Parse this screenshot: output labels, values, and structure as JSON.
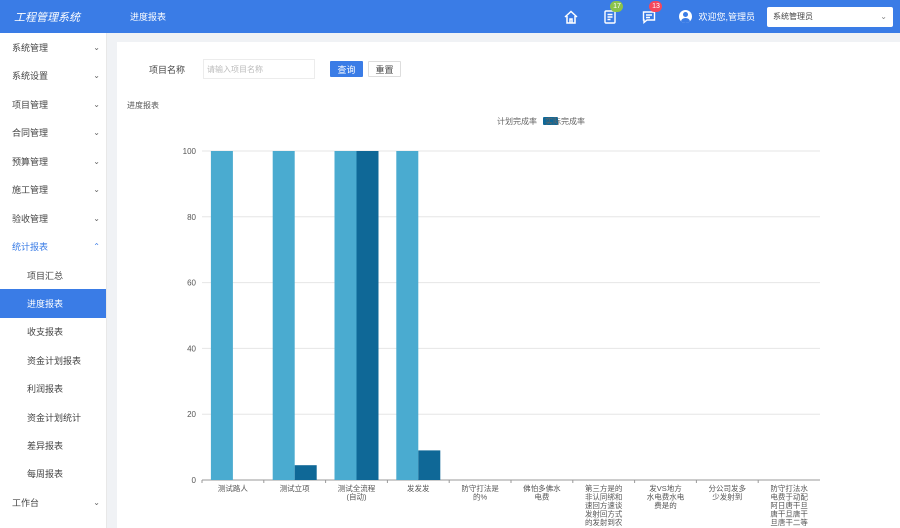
{
  "header": {
    "logo": "工程管理系统",
    "page_title": "进度报表",
    "badges": {
      "tasks": "17",
      "messages": "13"
    },
    "welcome": "欢迎您,管理员",
    "role_select": "系统管理员",
    "icons": [
      "home-icon",
      "task-list-icon",
      "message-icon",
      "user-avatar-icon",
      "chevron-down-icon"
    ]
  },
  "sidebar": {
    "items": [
      {
        "label": "系统管理"
      },
      {
        "label": "系统设置"
      },
      {
        "label": "项目管理"
      },
      {
        "label": "合同管理"
      },
      {
        "label": "预算管理"
      },
      {
        "label": "施工管理"
      },
      {
        "label": "验收管理"
      },
      {
        "label": "统计报表"
      }
    ],
    "sub_items": [
      {
        "label": "项目汇总"
      },
      {
        "label": "进度报表"
      },
      {
        "label": "收支报表"
      },
      {
        "label": "资金计划报表"
      },
      {
        "label": "利润报表"
      },
      {
        "label": "资金计划统计"
      },
      {
        "label": "差异报表"
      },
      {
        "label": "每周报表"
      }
    ],
    "bottom_item": {
      "label": "工作台"
    }
  },
  "search": {
    "label": "项目名称",
    "placeholder": "请输入项目名称",
    "query_button": "查询",
    "reset_button": "重置"
  },
  "colors": {
    "header": "#3a7ce6",
    "plan_bar": "#4aabd0",
    "actual_bar": "#0f6897"
  },
  "chart_data": {
    "type": "bar",
    "title": "进度报表",
    "categories": [
      "测试路人",
      "测试立项",
      "测试全流程\n(自动)",
      "发发发",
      "防守打法是\n的%",
      "佛怕多佛水\n电费",
      "第三方是的\n非认同绑和\n速回方速谈\n发射回方式\n的发射到农",
      "发VS地方\n水电费水电\n费是的",
      "分公司发多\n少发射到",
      "防守打法水\n电费于动配\n阿日唐干旦\n唐干旦唐干\n旦唐干二等"
    ],
    "series": [
      {
        "name": "计划完成率",
        "values": [
          100,
          100,
          100,
          100,
          0,
          0,
          0,
          0,
          0,
          0
        ]
      },
      {
        "name": "实际完成率",
        "values": [
          0,
          4.5,
          100,
          9,
          0,
          0,
          0,
          0,
          0,
          0
        ]
      }
    ],
    "ylim": [
      0,
      100
    ],
    "yticks": [
      0,
      20,
      40,
      60,
      80,
      100
    ],
    "grid": true,
    "legend_position": "top-center"
  }
}
